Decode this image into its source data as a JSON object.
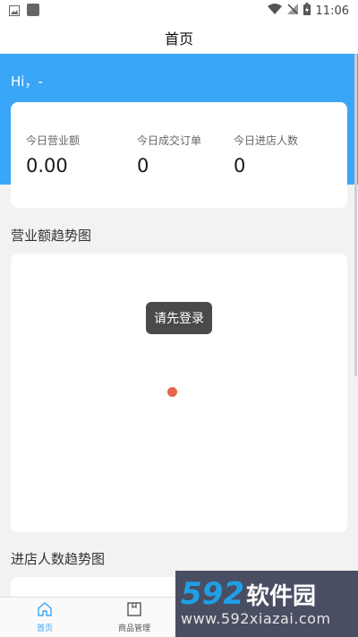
{
  "status_bar": {
    "time": "11:06"
  },
  "title": "首页",
  "greeting": "Hi，-",
  "stats": [
    {
      "label": "今日营业额",
      "value": "0.00"
    },
    {
      "label": "今日成交订单",
      "value": "0"
    },
    {
      "label": "今日进店人数",
      "value": "0"
    }
  ],
  "sections": {
    "revenue_trend": "营业额趋势图",
    "visitor_trend": "进店人数趋势图"
  },
  "toast": "请先登录",
  "tabs": [
    {
      "label": "首页",
      "icon": "home-icon",
      "active": true
    },
    {
      "label": "商品管理",
      "icon": "box-icon",
      "active": false
    },
    {
      "label": "",
      "icon": "document-icon",
      "active": false
    },
    {
      "label": "",
      "icon": "user-icon",
      "active": false
    }
  ],
  "watermark": {
    "number": "592",
    "text": "软件园",
    "url": "www.592xiazai.com"
  },
  "colors": {
    "accent": "#3aa6f7",
    "toast_bg": "#4a4a4a",
    "loader": "#e8644a"
  }
}
